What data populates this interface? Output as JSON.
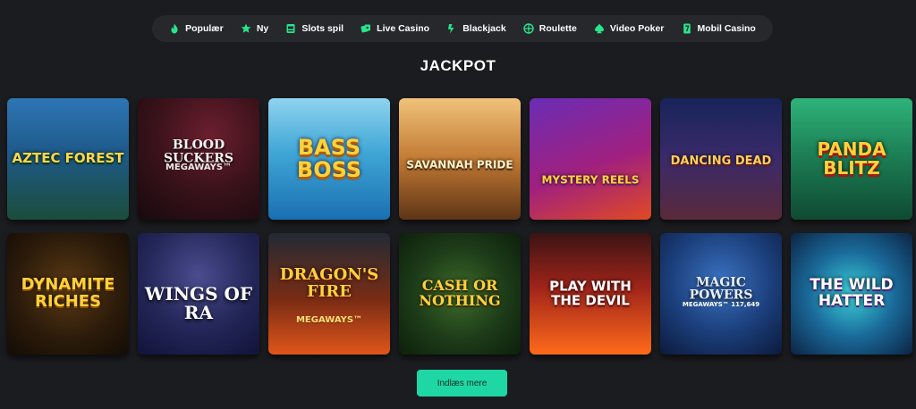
{
  "nav": {
    "items": [
      {
        "label": "Populær",
        "icon": "flame-icon"
      },
      {
        "label": "Ny",
        "icon": "star-icon"
      },
      {
        "label": "Slots spil",
        "icon": "slot-machine-icon"
      },
      {
        "label": "Live Casino",
        "icon": "live-casino-icon"
      },
      {
        "label": "Blackjack",
        "icon": "blackjack-icon"
      },
      {
        "label": "Roulette",
        "icon": "roulette-icon"
      },
      {
        "label": "Video Poker",
        "icon": "spade-icon"
      },
      {
        "label": "Mobil Casino",
        "icon": "mobile-icon"
      }
    ]
  },
  "section_title": "JACKPOT",
  "games": [
    {
      "name": "Aztec Forest"
    },
    {
      "name": "Blood Suckers",
      "sub": "Megaways™"
    },
    {
      "name": "Bass Boss"
    },
    {
      "name": "Savannah Pride"
    },
    {
      "name": "Mystery Reels"
    },
    {
      "name": "Dancing Dead"
    },
    {
      "name": "Panda Blitz"
    },
    {
      "name": "Dynamite Riches"
    },
    {
      "name": "Wings of Ra"
    },
    {
      "name": "Dragon's Fire",
      "sub": "Megaways™"
    },
    {
      "name": "Cash or Nothing"
    },
    {
      "name": "Play with the Devil"
    },
    {
      "name": "Magic Powers",
      "sub": "Megaways™ 117,649"
    },
    {
      "name": "The Wild Hatter"
    }
  ],
  "load_more_label": "Indlæs mere",
  "colors": {
    "accent": "#1ed7a5",
    "nav_icon": "#27e58a",
    "background": "#1b1c1f",
    "nav_bg": "#26282c"
  }
}
